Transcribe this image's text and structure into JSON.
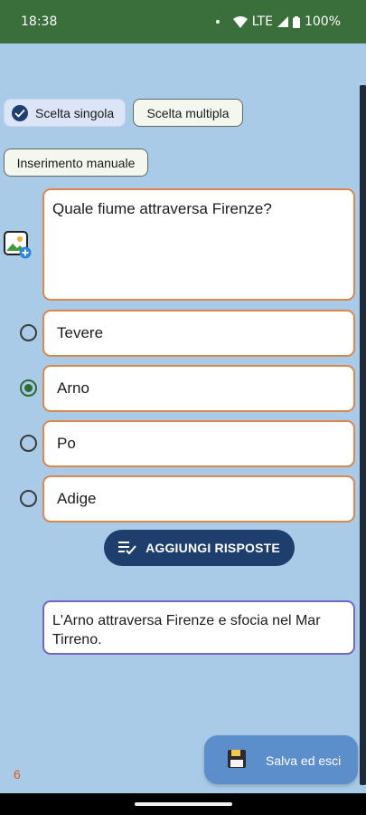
{
  "status_bar": {
    "time": "18:38",
    "network": "LTE",
    "battery": "100%"
  },
  "mode_chips": {
    "single": "Scelta singola",
    "multiple": "Scelta multipla",
    "manual": "Inserimento manuale",
    "selected": "single"
  },
  "question": {
    "text": "Quale fiume attraversa Firenze?"
  },
  "answers": [
    {
      "text": "Tevere",
      "selected": false
    },
    {
      "text": "Arno",
      "selected": true
    },
    {
      "text": "Po",
      "selected": false
    },
    {
      "text": "Adige",
      "selected": false
    }
  ],
  "add_answers_label": "AGGIUNGI RISPOSTE",
  "explanation": "L'Arno attraversa Firenze e sfocia nel Mar Tirreno.",
  "save_label": "Salva ed esci",
  "counter": "6",
  "colors": {
    "status_bar": "#3a6e3b",
    "background": "#a9cbe8",
    "primary": "#1e3f6e",
    "answer_border": "#d9874f",
    "explanation_border": "#7566c2",
    "save_button": "#5b8ecb",
    "selected_radio": "#2f6b35"
  },
  "icons": {
    "image_add": "image-add-icon",
    "check": "check-icon",
    "playlist_add_check": "playlist-check-icon",
    "save": "floppy-disk-icon"
  }
}
